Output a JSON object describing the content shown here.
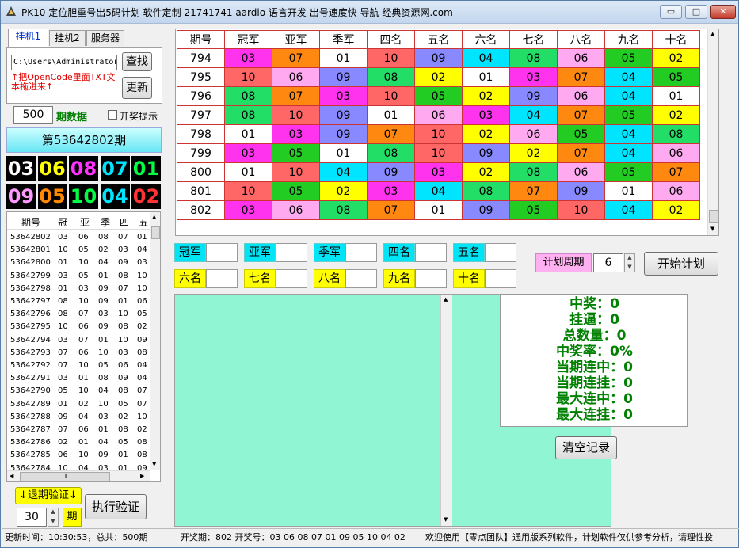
{
  "window": {
    "title": "PK10 定位胆重号出5码计划 软件定制 21741741 aardio 语言开发 出号速度快 导航 经典资源网.com",
    "min": "▭",
    "max": "□",
    "close": "✕"
  },
  "tabs": [
    "挂机1",
    "挂机2",
    "服务器"
  ],
  "path": {
    "value": "C:\\Users\\Administrator"
  },
  "find_btn": "查找",
  "update_btn": "更新",
  "tip": "↑把OpenCode里面TXT文本拖进来↑",
  "period_count": "500",
  "period_label": "期数据",
  "prize_toggle": "开奖提示",
  "current_period": "第53642802期",
  "balls": [
    {
      "n": "03",
      "c": "#ffffff"
    },
    {
      "n": "06",
      "c": "#ffff00"
    },
    {
      "n": "08",
      "c": "#ff33ff"
    },
    {
      "n": "07",
      "c": "#00e5ff"
    },
    {
      "n": "01",
      "c": "#00ff44"
    },
    {
      "n": "09",
      "c": "#ff99ff"
    },
    {
      "n": "05",
      "c": "#ff8800"
    },
    {
      "n": "10",
      "c": "#00ff44"
    },
    {
      "n": "04",
      "c": "#00e5ff"
    },
    {
      "n": "02",
      "c": "#ff3333"
    }
  ],
  "history": {
    "headers": [
      "期号",
      "冠",
      "亚",
      "季",
      "四",
      "五"
    ],
    "rows": [
      [
        "53642802",
        "03",
        "06",
        "08",
        "07",
        "01"
      ],
      [
        "53642801",
        "10",
        "05",
        "02",
        "03",
        "04"
      ],
      [
        "53642800",
        "01",
        "10",
        "04",
        "09",
        "03"
      ],
      [
        "53642799",
        "03",
        "05",
        "01",
        "08",
        "10"
      ],
      [
        "53642798",
        "01",
        "03",
        "09",
        "07",
        "10"
      ],
      [
        "53642797",
        "08",
        "10",
        "09",
        "01",
        "06"
      ],
      [
        "53642796",
        "08",
        "07",
        "03",
        "10",
        "05"
      ],
      [
        "53642795",
        "10",
        "06",
        "09",
        "08",
        "02"
      ],
      [
        "53642794",
        "03",
        "07",
        "01",
        "10",
        "09"
      ],
      [
        "53642793",
        "07",
        "06",
        "10",
        "03",
        "08"
      ],
      [
        "53642792",
        "07",
        "10",
        "05",
        "06",
        "04"
      ],
      [
        "53642791",
        "03",
        "01",
        "08",
        "09",
        "04"
      ],
      [
        "53642790",
        "05",
        "10",
        "04",
        "08",
        "07"
      ],
      [
        "53642789",
        "01",
        "02",
        "10",
        "05",
        "07"
      ],
      [
        "53642788",
        "09",
        "04",
        "03",
        "02",
        "10"
      ],
      [
        "53642787",
        "07",
        "06",
        "01",
        "08",
        "02"
      ],
      [
        "53642786",
        "02",
        "01",
        "04",
        "05",
        "08"
      ],
      [
        "53642785",
        "06",
        "10",
        "09",
        "01",
        "08"
      ],
      [
        "53642784",
        "10",
        "04",
        "03",
        "01",
        "09"
      ]
    ]
  },
  "scroll_arrows": {
    "up": "▲",
    "down": "▼",
    "left": "◀",
    "right": "▶",
    "grip": "⦀"
  },
  "backtest_btn": "↓退期验证↓",
  "backtest_value": "30",
  "backtest_unit": "期",
  "exec_btn": "执行验证",
  "grid": {
    "headers": [
      "期号",
      "冠军",
      "亚军",
      "季军",
      "四名",
      "五名",
      "六名",
      "七名",
      "八名",
      "九名",
      "十名"
    ],
    "rows": [
      [
        "794",
        "03",
        "07",
        "01",
        "10",
        "09",
        "04",
        "08",
        "06",
        "05",
        "02"
      ],
      [
        "795",
        "10",
        "06",
        "09",
        "08",
        "02",
        "01",
        "03",
        "07",
        "04",
        "05"
      ],
      [
        "796",
        "08",
        "07",
        "03",
        "10",
        "05",
        "02",
        "09",
        "06",
        "04",
        "01"
      ],
      [
        "797",
        "08",
        "10",
        "09",
        "01",
        "06",
        "03",
        "04",
        "07",
        "05",
        "02"
      ],
      [
        "798",
        "01",
        "03",
        "09",
        "07",
        "10",
        "02",
        "06",
        "05",
        "04",
        "08"
      ],
      [
        "799",
        "03",
        "05",
        "01",
        "08",
        "10",
        "09",
        "02",
        "07",
        "04",
        "06"
      ],
      [
        "800",
        "01",
        "10",
        "04",
        "09",
        "03",
        "02",
        "08",
        "06",
        "05",
        "07"
      ],
      [
        "801",
        "10",
        "05",
        "02",
        "03",
        "04",
        "08",
        "07",
        "09",
        "01",
        "06"
      ],
      [
        "802",
        "03",
        "06",
        "08",
        "07",
        "01",
        "09",
        "05",
        "10",
        "04",
        "02"
      ]
    ]
  },
  "num_colors": {
    "01": "#ffffff",
    "02": "#ffff00",
    "03": "#ff33ee",
    "04": "#00e5ff",
    "05": "#22cc22",
    "06": "#ffaaf0",
    "07": "#ff8811",
    "08": "#22dd66",
    "09": "#8888ff",
    "10": "#ff6666"
  },
  "positions": [
    "冠军",
    "亚军",
    "季军",
    "四名",
    "五名",
    "六名",
    "七名",
    "八名",
    "九名",
    "十名"
  ],
  "plan_label": "计划周期",
  "plan_value": "6",
  "start_btn": "开始计划",
  "stats": [
    "中奖：0",
    "挂逼：0",
    "总数量：0",
    "中奖率：0%",
    "当期连中：0",
    "当期连挂：0",
    "最大连中：0",
    "最大连挂：0"
  ],
  "clear_btn": "清空记录",
  "status": {
    "update": "更新时间：10:30:53，总共：500期",
    "draw": "开奖期：802 开奖号：03 06 08 07 01 09 05 10 04 02",
    "notice": "欢迎使用【零点团队】通用版系列软件，计划软件仅供参考分析，请理性投"
  }
}
